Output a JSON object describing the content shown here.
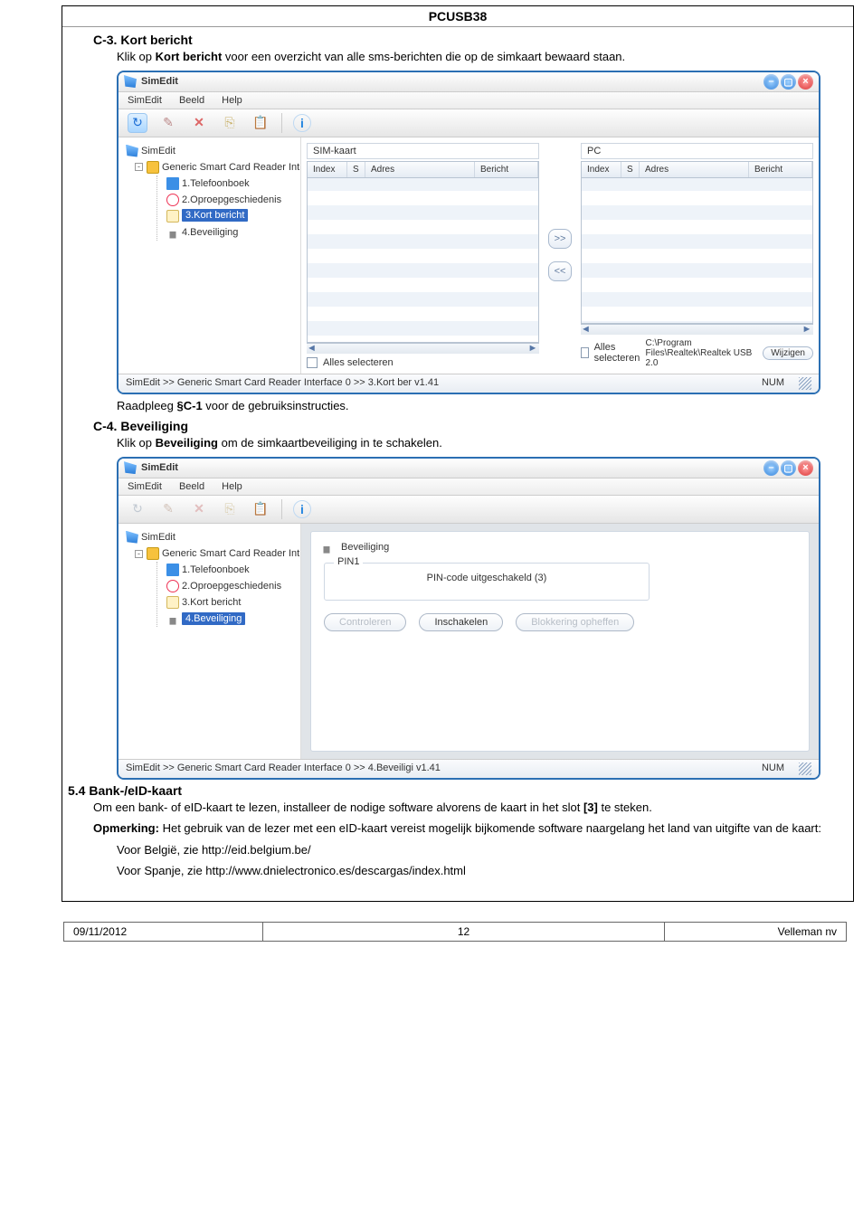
{
  "page": {
    "product": "PCUSB38",
    "footer_date": "09/11/2012",
    "footer_page": "12",
    "footer_company": "Velleman nv"
  },
  "c3": {
    "heading": "C-3. Kort bericht",
    "para_pre": "Klik op ",
    "para_bold": "Kort bericht",
    "para_post": " voor een overzicht van alle sms-berichten die op de simkaart bewaard staan.",
    "sub_pre": "Raadpleeg ",
    "sub_bold": "§C-1",
    "sub_post": " voor de gebruiksinstructies."
  },
  "c4": {
    "heading": "C-4. Beveiliging",
    "para_pre": "Klik op ",
    "para_bold": "Beveiliging",
    "para_post": " om de simkaartbeveiliging in te schakelen."
  },
  "s54": {
    "heading": "5.4 Bank-/eID-kaart",
    "p1_a": "Om een bank- of eID-kaart te lezen, installeer de nodige software alvorens de kaart in het slot ",
    "p1_b": "[3]",
    "p1_c": " te steken.",
    "p2_a": "Opmerking:",
    "p2_b": " Het gebruik van de lezer met een eID-kaart vereist mogelijk bijkomende software naargelang het land van uitgifte van de kaart:",
    "li1": "Voor België, zie http://eid.belgium.be/",
    "li2": "Voor Spanje, zie http://www.dnielectronico.es/descargas/index.html"
  },
  "app": {
    "title": "SimEdit",
    "menu": {
      "m1": "SimEdit",
      "m2": "Beeld",
      "m3": "Help"
    },
    "tree": {
      "root": "SimEdit",
      "reader": "Generic Smart Card Reader Int",
      "items": {
        "phonebook": "1.Telefoonboek",
        "history": "2.Oproepgeschiedenis",
        "sms": "3.Kort bericht",
        "security": "4.Beveiliging"
      }
    },
    "grid": {
      "left_label": "SIM-kaart",
      "right_label": "PC",
      "col_index": "Index",
      "col_s": "S",
      "col_adres": "Adres",
      "col_bericht": "Bericht",
      "select_all": "Alles selecteren",
      "path_pc": "C:\\Program Files\\Realtek\\Realtek USB 2.0",
      "btn_change": "Wijzigen",
      "move_right": ">>",
      "move_left": "<<",
      "scroll_left": "◄",
      "scroll_right": "►"
    },
    "status": {
      "sb1": "SimEdit  >>  Generic Smart Card Reader Interface 0  >>  3.Kort ber v1.41",
      "sb2": "SimEdit  >>  Generic Smart Card Reader Interface 0  >>  4.Beveiligi v1.41",
      "num": "NUM"
    },
    "sec": {
      "panel_title": "Beveiliging",
      "pin_legend": "PIN1",
      "pin_msg": "PIN-code uitgeschakeld (3)",
      "btn_control": "Controleren",
      "btn_enable": "Inschakelen",
      "btn_unblock": "Blokkering opheffen"
    }
  }
}
